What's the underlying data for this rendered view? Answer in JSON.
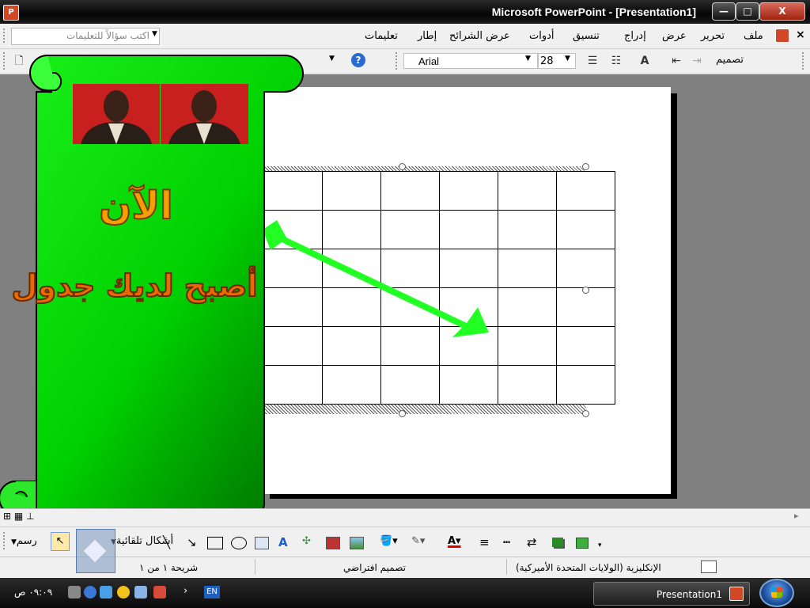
{
  "window": {
    "title": "Microsoft PowerPoint - [Presentation1]",
    "app_icon_text": "P",
    "min_label": "—",
    "max_label": "□",
    "close_label": "X"
  },
  "menu": {
    "help_placeholder": "اكتب سؤالاً للتعليمات",
    "close_x": "×",
    "items": [
      "ملف",
      "تحرير",
      "عرض",
      "إدراج",
      "تنسيق",
      "أدوات",
      "عرض الشرائح",
      "إطار",
      "تعليمات"
    ]
  },
  "toolbar": {
    "font": "Arial",
    "size": "28",
    "design_label": "تصميم",
    "help_icon": "?"
  },
  "slide": {
    "headline_1": "الآن",
    "headline_2": "أصبح لديك جدول",
    "table_rows": 6,
    "table_cols": 6
  },
  "drawing_bar": {
    "draw_label": "رسم",
    "autoshapes_label": "أشكال تلقائية"
  },
  "status": {
    "slide_info": "شريحة ١ من ١",
    "design": "تصميم افتراضي",
    "language": "الإنكليزية (الولايات المتحدة الأميركية)"
  },
  "taskbar": {
    "task_label": "Presentation1",
    "lang": "EN",
    "clock": "٠٩:٠٩ ص"
  },
  "colors": {
    "banner_green": "#00d000",
    "arrow_green": "#22ff22",
    "text_orange": "#e86a00"
  }
}
